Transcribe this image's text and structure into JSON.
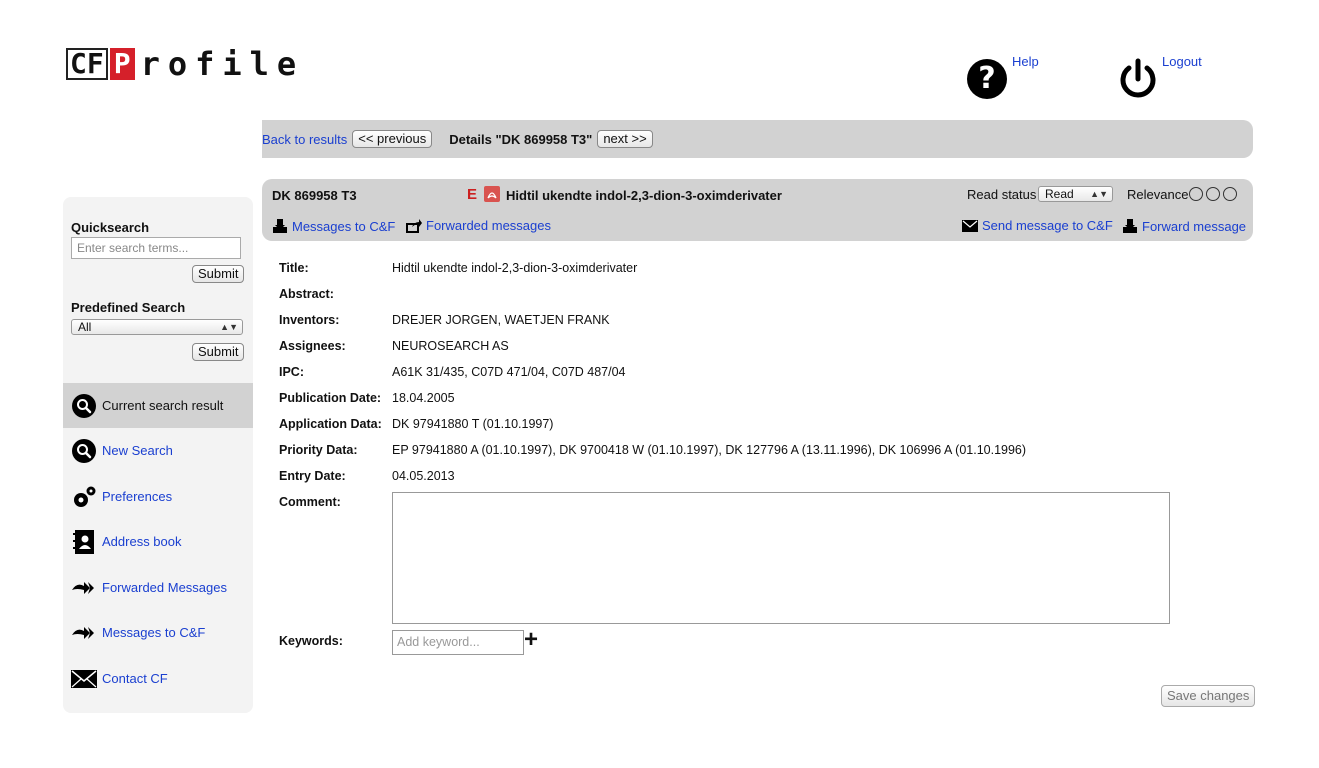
{
  "logo": {
    "part1": "CF",
    "part2": "P",
    "part3": "rofile"
  },
  "header": {
    "help_label": "Help",
    "logout_label": "Logout",
    "help_glyph": "?"
  },
  "nav": {
    "back_label": "Back to results",
    "prev_label": "<< previous",
    "details_label": "Details \"DK 869958 T3\"",
    "next_label": "next >>"
  },
  "sidebar": {
    "quicksearch_label": "Quicksearch",
    "quicksearch_placeholder": "Enter search terms...",
    "submit_label": "Submit",
    "predefined_label": "Predefined Search",
    "predefined_value": "All",
    "items": [
      {
        "label": "Current search result",
        "icon": "search-icon"
      },
      {
        "label": "New Search",
        "icon": "search-icon"
      },
      {
        "label": "Preferences",
        "icon": "gears-icon"
      },
      {
        "label": "Address book",
        "icon": "address-book-icon"
      },
      {
        "label": "Forwarded Messages",
        "icon": "double-arrow-icon"
      },
      {
        "label": "Messages to C&F",
        "icon": "double-arrow-icon"
      },
      {
        "label": "Contact CF",
        "icon": "envelope-icon"
      }
    ]
  },
  "detail": {
    "number": "DK 869958 T3",
    "badge": "E",
    "title": "Hidtil ukendte indol-2,3-dion-3-oximderivater",
    "read_status_label": "Read status",
    "read_status_value": "Read",
    "relevance_label": "Relevance",
    "links": {
      "messages_to": "Messages to C&F",
      "forwarded": "Forwarded messages",
      "send_message": "Send message to C&F",
      "forward_message": "Forward message"
    }
  },
  "fields": [
    {
      "label": "Title:",
      "value": "Hidtil ukendte indol-2,3-dion-3-oximderivater"
    },
    {
      "label": "Abstract:",
      "value": ""
    },
    {
      "label": "Inventors:",
      "value": "DREJER JORGEN, WAETJEN FRANK"
    },
    {
      "label": "Assignees:",
      "value": "NEUROSEARCH AS"
    },
    {
      "label": "IPC:",
      "value": "A61K 31/435, C07D 471/04, C07D 487/04"
    },
    {
      "label": "Publication Date:",
      "value": "18.04.2005"
    },
    {
      "label": "Application Data:",
      "value": "DK 97941880 T (01.10.1997)"
    },
    {
      "label": "Priority Data:",
      "value": "EP 97941880 A (01.10.1997), DK 9700418 W (01.10.1997), DK 127796 A (13.11.1996), DK 106996 A (01.10.1996)"
    },
    {
      "label": "Entry Date:",
      "value": "04.05.2013"
    },
    {
      "label": "Comment:",
      "value": ""
    }
  ],
  "keywords": {
    "label": "Keywords:",
    "placeholder": "Add keyword...",
    "add_glyph": "+"
  },
  "save_label": "Save changes"
}
